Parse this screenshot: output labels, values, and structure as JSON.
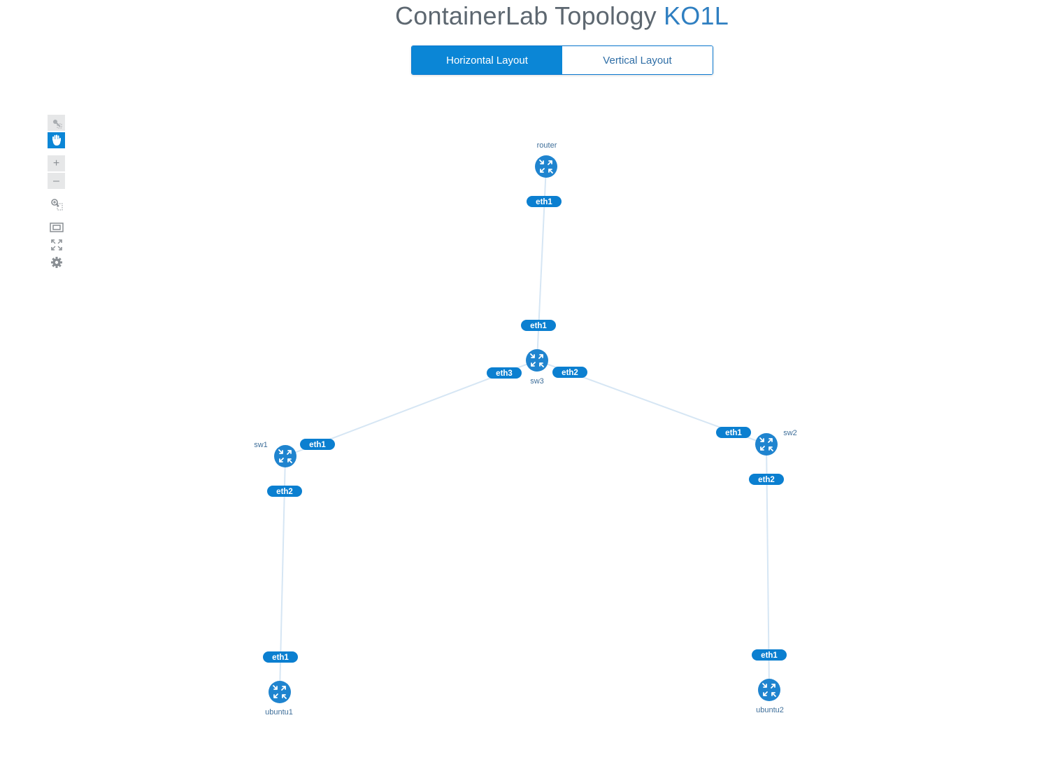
{
  "header": {
    "title_main": "ContainerLab Topology",
    "title_accent": "KO1L"
  },
  "layout_toggle": {
    "horizontal_label": "Horizontal Layout",
    "vertical_label": "Vertical Layout",
    "selected": "Horizontal Layout"
  },
  "toolbar": {
    "tools": [
      "select-icon",
      "pan-hand-icon",
      "zoom-in-icon",
      "zoom-out-icon",
      "zoom-selection-icon",
      "fit-view-icon",
      "fullscreen-icon",
      "settings-icon"
    ],
    "zoom_in": "+",
    "zoom_out": "–"
  },
  "colors": {
    "accent": "#0b86d6",
    "node": "#1f84cf",
    "link": "#d6e6f4",
    "title_text": "#5d6770"
  },
  "topology": {
    "nodes": {
      "router": "router",
      "sw3": "sw3",
      "sw1": "sw1",
      "sw2": "sw2",
      "ubuntu1": "ubuntu1",
      "ubuntu2": "ubuntu2"
    },
    "links": [
      {
        "source": "router",
        "source_port": "eth1",
        "target": "sw3",
        "target_port": "eth1"
      },
      {
        "source": "sw3",
        "source_port": "eth3",
        "target": "sw1",
        "target_port": "eth1"
      },
      {
        "source": "sw3",
        "source_port": "eth2",
        "target": "sw2",
        "target_port": "eth1"
      },
      {
        "source": "sw1",
        "source_port": "eth2",
        "target": "ubuntu1",
        "target_port": "eth1"
      },
      {
        "source": "sw2",
        "source_port": "eth2",
        "target": "ubuntu2",
        "target_port": "eth1"
      }
    ]
  }
}
